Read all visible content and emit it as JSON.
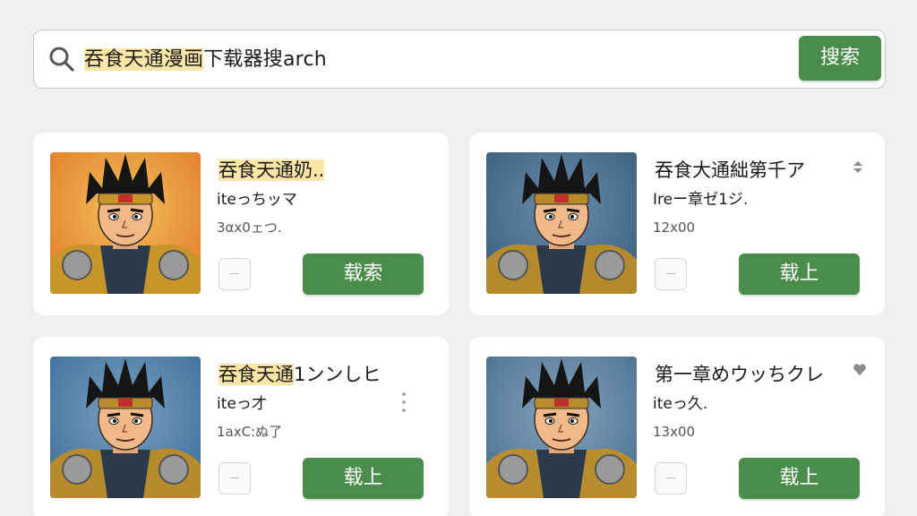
{
  "search": {
    "query_highlight": "吞食天通漫画",
    "query_rest": "下载器搜arch",
    "button_label": "搜索"
  },
  "cards": [
    {
      "title_highlight": "吞食天通奶..",
      "title_rest": "",
      "subtitle": "iteっちッマ",
      "meta": "3αx0ェつ.",
      "button_label": "载索",
      "icon": "sort-icon",
      "art": {
        "bg": "#e07b2a",
        "bg2": "#f3c25a",
        "armor": "#c7962a"
      }
    },
    {
      "title_highlight": "",
      "title_rest": "吞食大通絀第千ア",
      "subtitle": "Ireー章ゼ1ジ.",
      "meta": "12x00",
      "button_label": "载上",
      "icon": "sort-icon",
      "art": {
        "bg": "#3c5f7d",
        "bg2": "#6a8cab",
        "armor": "#b48a2c"
      }
    },
    {
      "title_highlight": "吞食天通",
      "title_rest": "1ンンしヒ",
      "subtitle": "iteっ才",
      "meta": "1axC:ぬ了",
      "button_label": "载上",
      "icon": "kebab-icon",
      "art": {
        "bg": "#3d6f99",
        "bg2": "#7ca0c2",
        "armor": "#b58b2e"
      }
    },
    {
      "title_highlight": "",
      "title_rest": "第一章めウッちクレ",
      "subtitle": "iteっ久.",
      "meta": "13x00",
      "button_label": "载上",
      "icon": "heart-icon",
      "art": {
        "bg": "#4a7090",
        "bg2": "#86a4bd",
        "armor": "#b88d30"
      }
    }
  ],
  "colors": {
    "accent": "#4a8d4a",
    "highlight": "#fbe6a6",
    "background": "#efefef"
  }
}
